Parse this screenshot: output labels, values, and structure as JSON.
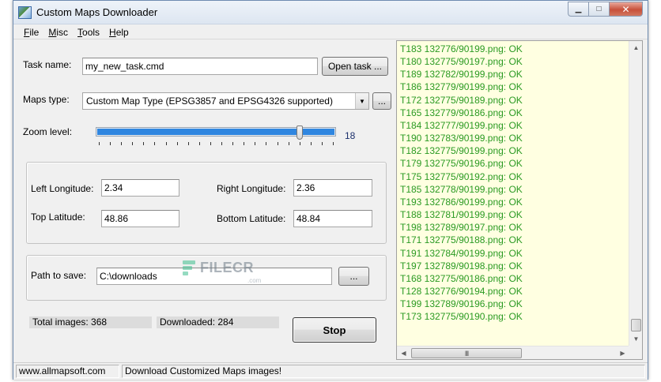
{
  "window": {
    "title": "Custom Maps Downloader",
    "min_icon": "minimize-icon",
    "max_icon": "maximize-icon",
    "close_icon": "close-icon"
  },
  "menu": [
    {
      "label": "File",
      "accel": "F",
      "rest": "ile"
    },
    {
      "label": "Misc",
      "accel": "M",
      "rest": "isc"
    },
    {
      "label": "Tools",
      "accel": "T",
      "rest": "ools"
    },
    {
      "label": "Help",
      "accel": "H",
      "rest": "elp"
    }
  ],
  "task": {
    "label": "Task name:",
    "value": "my_new_task.cmd",
    "open_button": "Open task ..."
  },
  "maps_type": {
    "label": "Maps type:",
    "selected": "Custom Map Type (EPSG3857 and EPSG4326 supported)",
    "browse_button": "..."
  },
  "zoom": {
    "label": "Zoom level:",
    "value": "18",
    "level": 18,
    "max": 21
  },
  "coords": {
    "left_lon_label": "Left Longitude:",
    "left_lon_value": "2.34",
    "right_lon_label": "Right Longitude:",
    "right_lon_value": "2.36",
    "top_lat_label": "Top Latitude:",
    "top_lat_value": "48.86",
    "bottom_lat_label": "Bottom Latitude:",
    "bottom_lat_value": "48.84"
  },
  "save": {
    "label": "Path to save:",
    "value": "C:\\downloads",
    "browse_button": "..."
  },
  "progress": {
    "total_text": "Total images: 368",
    "downloaded_text": "Downloaded: 284",
    "stop_button": "Stop"
  },
  "watermark": {
    "text": "FILECR",
    "sub": ".com"
  },
  "log": [
    "T183 132776/90199.png: OK",
    "T180 132775/90197.png: OK",
    "T189 132782/90199.png: OK",
    "T186 132779/90199.png: OK",
    "T172 132775/90189.png: OK",
    "T165 132779/90186.png: OK",
    "T184 132777/90199.png: OK",
    "T190 132783/90199.png: OK",
    "T182 132775/90199.png: OK",
    "T179 132775/90196.png: OK",
    "T175 132775/90192.png: OK",
    "T185 132778/90199.png: OK",
    "T193 132786/90199.png: OK",
    "T188 132781/90199.png: OK",
    "T198 132789/90197.png: OK",
    "T171 132775/90188.png: OK",
    "T191 132784/90199.png: OK",
    "T197 132789/90198.png: OK",
    "T168 132775/90186.png: OK",
    "T128 132776/90194.png: OK",
    "T199 132789/90196.png: OK",
    "T173 132775/90190.png: OK"
  ],
  "log_scroll": {
    "up_icon": "scroll-up-arrow-icon",
    "down_icon": "scroll-down-arrow-icon",
    "left_icon": "scroll-left-arrow-icon",
    "right_icon": "scroll-right-arrow-icon",
    "thumb_grip": "III"
  },
  "statusbar": {
    "website": "www.allmapsoft.com",
    "message": "Download Customized Maps images!"
  },
  "colors": {
    "log_background": "#ffffe1",
    "log_text": "#2a9a22",
    "slider_fill": "#2f86e0",
    "close_button": "#c7503a"
  }
}
